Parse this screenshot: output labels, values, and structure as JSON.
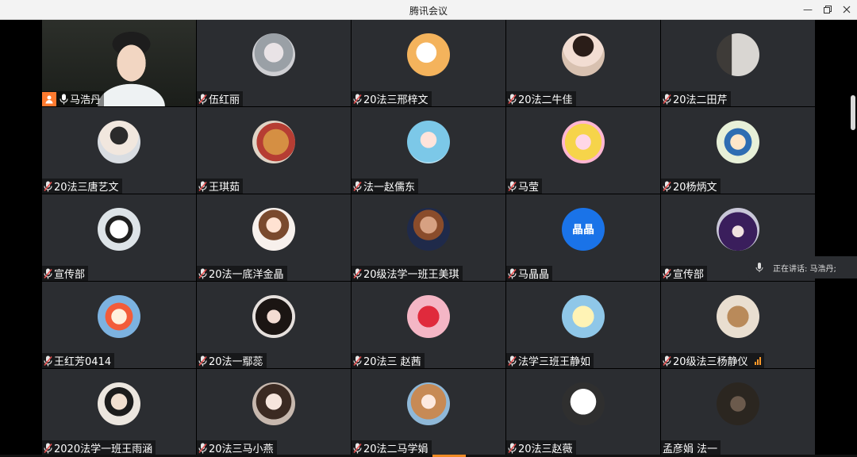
{
  "window": {
    "title": "腾讯会议"
  },
  "speaking": {
    "label": "正在讲话: 马浩丹;"
  },
  "colors": {
    "accent": "#ff7a2f",
    "active_speaker_border": "#3fae54",
    "tile_bg": "#2b2d31",
    "avatar_blue": "#1a73e8"
  },
  "participants": [
    {
      "name": "马浩丹",
      "video": true,
      "host": true,
      "mic": "active"
    },
    {
      "name": "伍红丽",
      "avatar": "photo-avatar"
    },
    {
      "name": "20法三邢梓文",
      "avatar": "duck-avatar"
    },
    {
      "name": "20法二牛佳",
      "avatar": "girl-with-cat-avatar"
    },
    {
      "name": "20法二田芹",
      "avatar": "window-cat-avatar"
    },
    {
      "name": "20法三唐艺文",
      "avatar": "boy-avatar"
    },
    {
      "name": "王琪茹",
      "avatar": "cat-avatar"
    },
    {
      "name": "法一赵儒东",
      "avatar": "anime-girl-avatar"
    },
    {
      "name": "马莹",
      "avatar": "cartoon-girl-avatar"
    },
    {
      "name": "20杨炳文",
      "avatar": "cartoon-boy-avatar"
    },
    {
      "name": "宣传部",
      "avatar": "panda-avatar"
    },
    {
      "name": "20法一底洋金晶",
      "avatar": "illustrated-girl-avatar"
    },
    {
      "name": "20级法学一班王美琪",
      "avatar": "man-portrait-avatar"
    },
    {
      "name": "马晶晶",
      "avatar_text": "晶晶"
    },
    {
      "name": "宣传部",
      "avatar": "hooded-girl-avatar"
    },
    {
      "name": "王红芳0414",
      "avatar": "cartoon-kid-avatar"
    },
    {
      "name": "20法一鄢蕊",
      "avatar": "girl-photo-avatar"
    },
    {
      "name": "20法三 赵茜",
      "avatar": "red-fish-avatar"
    },
    {
      "name": "法学三班王静如",
      "avatar": "bear-avatar"
    },
    {
      "name": "20级法三杨静仪",
      "avatar": "dog-avatar",
      "signal": true
    },
    {
      "name": "2020法学一班王雨涵",
      "avatar": "headband-kid-avatar"
    },
    {
      "name": "20法三马小燕",
      "avatar": "girl-selfie-avatar"
    },
    {
      "name": "20法二马学娟",
      "avatar": "sketch-girl-avatar"
    },
    {
      "name": "20法三赵薇",
      "avatar": "white-bear-avatar"
    },
    {
      "name": "孟彦娟 法一",
      "avatar": "dark-photo-avatar",
      "mic": "none"
    }
  ]
}
